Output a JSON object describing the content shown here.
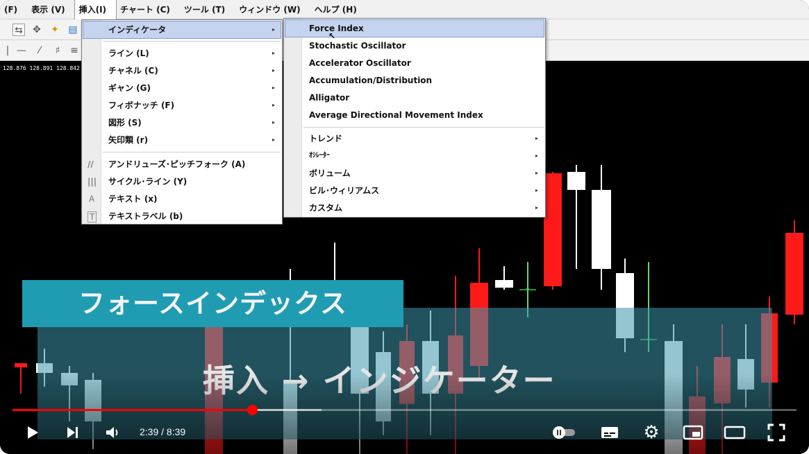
{
  "menubar": {
    "items": [
      "(F)",
      "表示 (V)",
      "挿入(I)",
      "チャート (C)",
      "ツール (T)",
      "ウィンドウ (W)",
      "ヘルプ (H)"
    ]
  },
  "price_readout": "128.876 128.891 128.842",
  "insert_menu": {
    "items": [
      {
        "label": "インディケータ",
        "submenu": true
      },
      {
        "label": "ライン (L)",
        "submenu": true
      },
      {
        "label": "チャネル (C)",
        "submenu": true
      },
      {
        "label": "ギャン (G)",
        "submenu": true
      },
      {
        "label": "フィボナッチ (F)",
        "submenu": true
      },
      {
        "label": "図形 (S)",
        "submenu": true
      },
      {
        "label": "矢印類 (r)",
        "submenu": true
      },
      {
        "label": "アンドリューズ･ピッチフォーク (A)",
        "submenu": false
      },
      {
        "label": "サイクル･ライン (Y)",
        "submenu": false
      },
      {
        "label": "テキスト (x)",
        "submenu": false
      },
      {
        "label": "テキストラベル (b)",
        "submenu": false
      }
    ]
  },
  "indicator_menu": {
    "items": [
      {
        "label": "Force Index",
        "submenu": false
      },
      {
        "label": "Stochastic Oscillator",
        "submenu": false
      },
      {
        "label": "Accelerator Oscillator",
        "submenu": false
      },
      {
        "label": "Accumulation/Distribution",
        "submenu": false
      },
      {
        "label": "Alligator",
        "submenu": false
      },
      {
        "label": "Average Directional Movement Index",
        "submenu": false
      },
      {
        "label": "トレンド",
        "submenu": true
      },
      {
        "label": "ｵｼﾚｰﾀｰ",
        "submenu": true
      },
      {
        "label": "ボリューム",
        "submenu": true
      },
      {
        "label": "ビル･ウィリアムス",
        "submenu": true
      },
      {
        "label": "カスタム",
        "submenu": true
      }
    ]
  },
  "caption": {
    "title": "フォースインデックス",
    "subtitle": "挿入 → インジケーター"
  },
  "player": {
    "time": "2:39 / 8:39",
    "progress": 0.306,
    "buffered": 0.394
  },
  "colors": {
    "bull_candle": "#ffffff",
    "bear_candle": "#ff1a1a",
    "caption_bg": "#1f9cb2",
    "progress": "#ff0000"
  }
}
